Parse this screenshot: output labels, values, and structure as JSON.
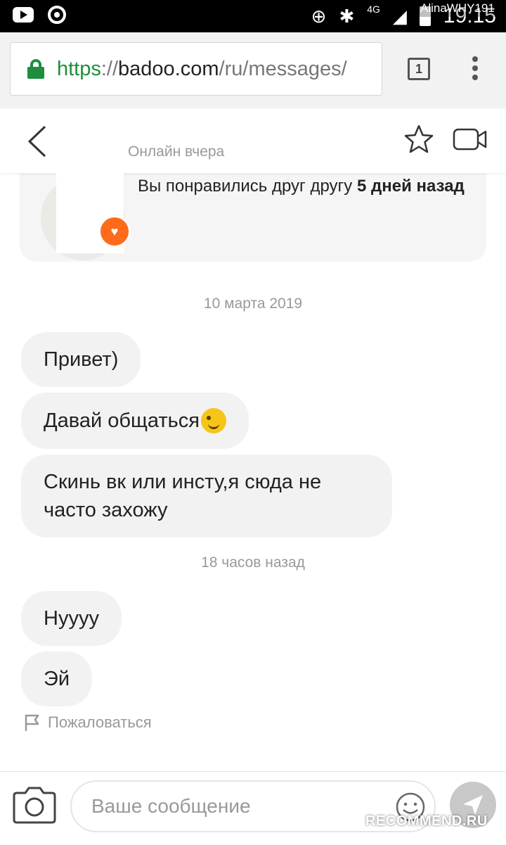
{
  "status_bar": {
    "time": "19:15",
    "network": "4G",
    "icons": [
      "youtube-icon",
      "chrome-icon",
      "data-saver-icon",
      "bluetooth-icon",
      "signal-icon",
      "battery-icon"
    ]
  },
  "overlay_username": "AlinaWHY191",
  "browser": {
    "url_scheme": "https",
    "url_separator": "://",
    "url_host": "badoo.com",
    "url_path": "/ru/messages/",
    "tab_count": "1"
  },
  "chat_header": {
    "status": "Онлайн вчера"
  },
  "match_card": {
    "text_main": "Вы понравились друг другу ",
    "text_bold": "5 дней назад"
  },
  "messages": [
    {
      "date_label": "10 марта 2019"
    },
    {
      "text": "Привет)"
    },
    {
      "text": "Давай общаться"
    },
    {
      "text": "Скинь вк или инсту,я сюда не часто захожу"
    },
    {
      "date_label": "18 часов назад"
    },
    {
      "text": "Нуууу"
    },
    {
      "text": "Эй"
    }
  ],
  "report_label": "Пожаловаться",
  "composer": {
    "placeholder": "Ваше сообщение"
  },
  "watermark": "RECOMMEND.RU",
  "colors": {
    "accent_green": "#1e8e3e",
    "badge_orange": "#ff6b1a",
    "bubble_bg": "#f2f2f2"
  }
}
